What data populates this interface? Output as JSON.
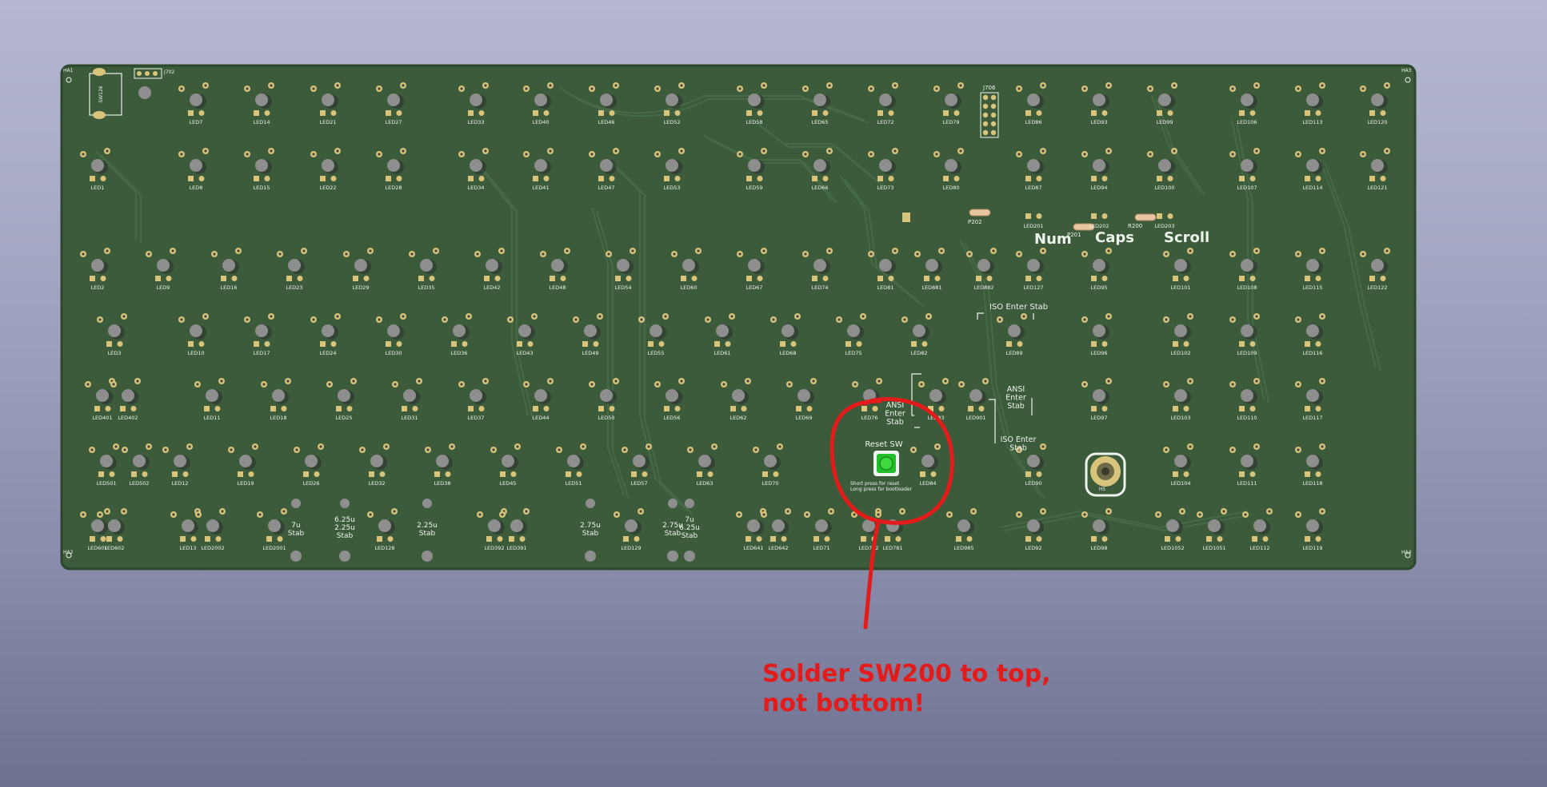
{
  "colors": {
    "board": "#3b5b3b",
    "board_edge": "#2c472c",
    "copper": "#d8c47a",
    "silk": "#eef3ee",
    "annotation": "#e31b1b",
    "reset_switch": "#22c02a"
  },
  "labels": {
    "num": "Num",
    "caps": "Caps",
    "scroll": "Scroll",
    "iso_stab_top": "ISO Enter Stab",
    "ansi_left": "ANSI\nEnter\nStab",
    "ansi_right": "ANSI\nEnter\nStab",
    "iso_stab_bottom": "ISO Enter\nStab",
    "reset_sw": "Reset SW",
    "reset_hint_1": "Short press for reset",
    "reset_hint_2": "Long press for bootloader",
    "stab_7u": "7u\nStab",
    "stab_625_225": "6.25u\n2.25u\nStab",
    "stab_225": "2.25u\nStab",
    "stab_275_a": "2.75u\nStab",
    "stab_275_b": "2.75u\nStab",
    "stab_7_625": "7u\n6.25u\nStab",
    "j706": "J706",
    "j702": "J702",
    "sw126": "SW126",
    "p202": "P202",
    "p201": "P201",
    "r200": "R200",
    "h5": "H5",
    "ha1": "HA1",
    "ha2": "HA2",
    "ha3": "HA3",
    "ha4": "HA4"
  },
  "annotation": "Solder SW200 to top, not bottom!",
  "leds": {
    "row1": [
      "LED7",
      "LED14",
      "LED21",
      "LED27",
      "LED33",
      "LED40",
      "LED46",
      "LED52",
      "LED58",
      "LED65",
      "LED72",
      "LED79",
      "LED86",
      "LED93",
      "LED99",
      "LED106",
      "LED113",
      "LED120"
    ],
    "row2": [
      "LED1",
      "LED8",
      "LED15",
      "LED22",
      "LED28",
      "LED34",
      "LED41",
      "LED47",
      "LED53",
      "LED59",
      "LED66",
      "LED73",
      "LED80",
      "LED87",
      "LED94",
      "LED100",
      "LED107",
      "LED114",
      "LED121"
    ],
    "row2b": [
      "LED201",
      "LED202",
      "LED203"
    ],
    "row3": [
      "LED2",
      "LED9",
      "LED16",
      "LED23",
      "LED29",
      "LED35",
      "LED42",
      "LED48",
      "LED54",
      "LED60",
      "LED67",
      "LED74",
      "LED81",
      "LED881",
      "LED882",
      "LED127",
      "LED95",
      "LED101",
      "LED108",
      "LED115",
      "LED122"
    ],
    "row4": [
      "LED3",
      "LED10",
      "LED17",
      "LED24",
      "LED30",
      "LED36",
      "LED43",
      "LED49",
      "LED55",
      "LED61",
      "LED68",
      "LED75",
      "LED82",
      "LED89",
      "LED96",
      "LED102",
      "LED109",
      "LED116"
    ],
    "row5": [
      "LED401",
      "LED402",
      "LED11",
      "LED18",
      "LED25",
      "LED31",
      "LED37",
      "LED44",
      "LED50",
      "LED56",
      "LED62",
      "LED69",
      "LED76",
      "LED83",
      "LED901",
      "LED97",
      "LED103",
      "LED110",
      "LED117"
    ],
    "row6": [
      "LED501",
      "LED502",
      "LED12",
      "LED19",
      "LED26",
      "LED32",
      "LED38",
      "LED45",
      "LED51",
      "LED57",
      "LED63",
      "LED70",
      "LED84",
      "LED90",
      "LED104",
      "LED111",
      "LED118"
    ],
    "row7": [
      "LED601",
      "LED602",
      "LED13",
      "LED2002",
      "LED2001",
      "LED128",
      "LED392",
      "LED391",
      "LED129",
      "LED641",
      "LED642",
      "LED71",
      "LED782",
      "LED781",
      "LED1052",
      "LED1051",
      "LED112",
      "LED119",
      "LED985",
      "LED92",
      "LED98"
    ]
  }
}
